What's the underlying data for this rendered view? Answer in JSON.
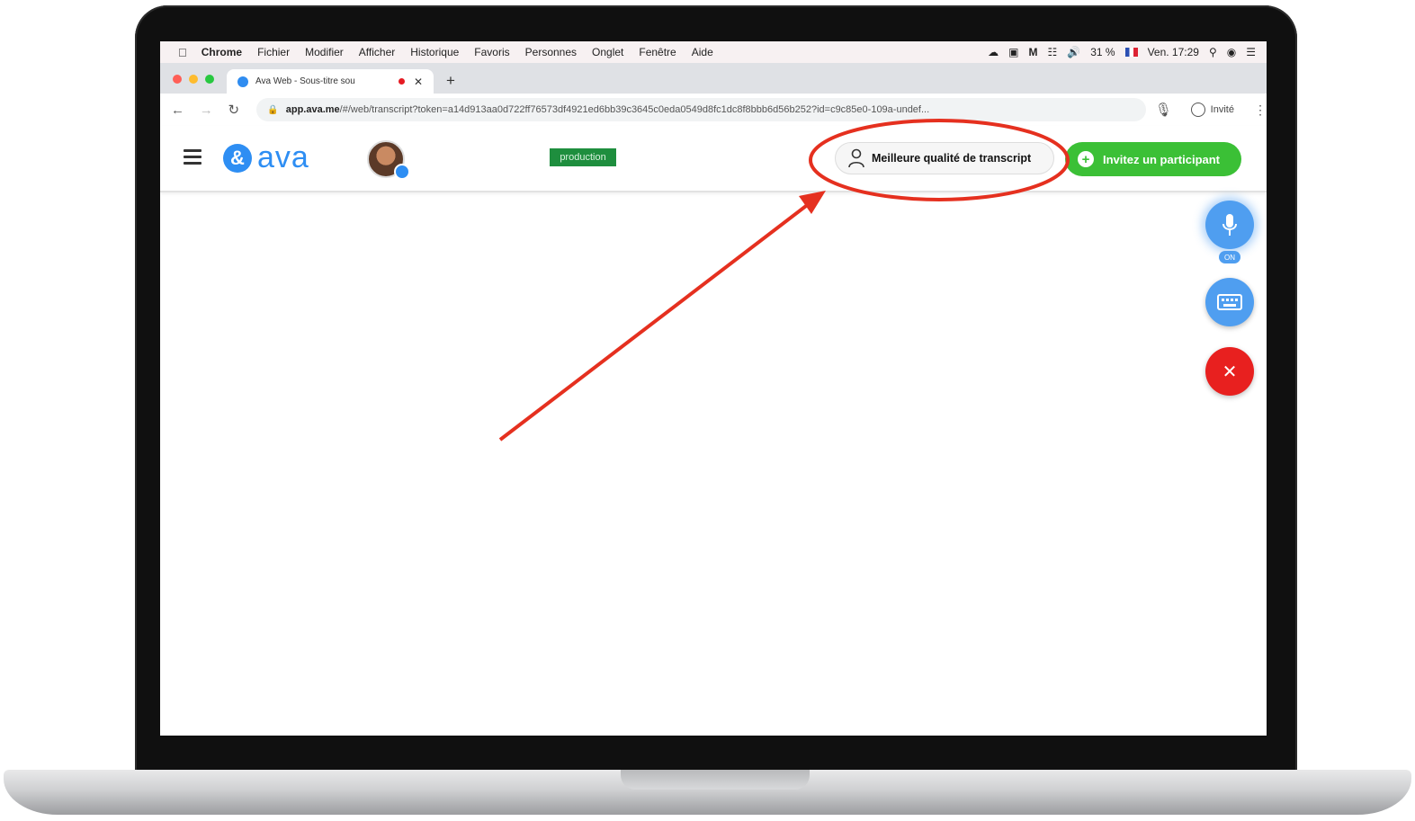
{
  "menubar": {
    "app": "Chrome",
    "items": [
      "Fichier",
      "Modifier",
      "Afficher",
      "Historique",
      "Favoris",
      "Personnes",
      "Onglet",
      "Fenêtre",
      "Aide"
    ],
    "battery": "31 %",
    "datetime": "Ven. 17:29"
  },
  "browser": {
    "tab_title": "Ava Web - Sous-titre sou",
    "url_domain": "app.ava.me",
    "url_path": "/#/web/transcript?token=a14d913aa0d722ff76573df4921ed6bb39c3645c0eda0549d8fc1dc8f8bbb6d56b252?id=c9c85e0-109a-undef...",
    "profile_label": "Invité"
  },
  "app": {
    "logo_text": "ava",
    "env_badge": "production",
    "quality_button_label": "Meilleure qualité de transcript",
    "invite_button_label": "Invitez un participant",
    "mic_label": "ON"
  },
  "colors": {
    "brand_blue": "#2e8ef3",
    "invite_green": "#3bc036",
    "close_red": "#e8201f",
    "annotation_red": "#e5301f",
    "env_green": "#1e8e3e"
  }
}
